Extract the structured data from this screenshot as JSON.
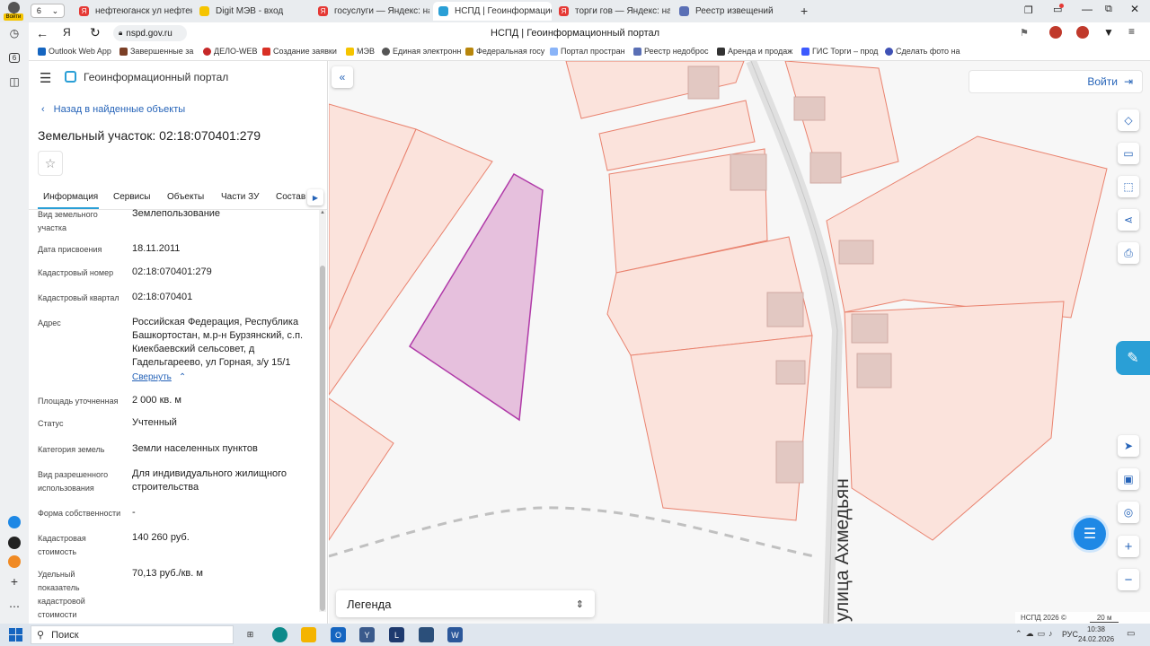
{
  "browser": {
    "tab_count": "6",
    "tabs": [
      {
        "title": "нефтеюганск ул нефтеюга",
        "fav": "#e53935"
      },
      {
        "title": "Digit МЭВ - вход",
        "fav": "#f5c400"
      },
      {
        "title": "госуслуги — Яндекс: нашл",
        "fav": "#e53935"
      },
      {
        "title": "НСПД | Геоинформацио",
        "fav": "#2a9fd6"
      },
      {
        "title": "торги гов — Яндекс: нашл",
        "fav": "#e53935"
      },
      {
        "title": "Реестр извещений",
        "fav": "#5a6fb5"
      }
    ],
    "url": "nspd.gov.ru",
    "page_title": "НСПД | Геоинформационный портал",
    "login_label": "Войти",
    "bookmarks": [
      "Outlook Web App",
      "Завершенные за",
      "ДЕЛО-WEB",
      "Создание заявки",
      "МЭВ",
      "Единая электронн",
      "Федеральная госу",
      "Портал простран",
      "Реестр недоброс",
      "Аренда и продаж",
      "ГИС Торги – прод",
      "Сделать фото на"
    ]
  },
  "panel": {
    "portal_title": "Геоинформационный портал",
    "back_link": "Назад в найденные объекты",
    "object_title": "Земельный участок: 02:18:070401:279",
    "tabs": [
      "Информация",
      "Сервисы",
      "Объекты",
      "Части ЗУ",
      "Состав"
    ],
    "fields": [
      {
        "label": "Вид земельного участка",
        "value": "Землепользование"
      },
      {
        "label": "Дата присвоения",
        "value": "18.11.2011"
      },
      {
        "label": "Кадастровый номер",
        "value": "02:18:070401:279"
      },
      {
        "label": "Кадастровый квартал",
        "value": "02:18:070401"
      },
      {
        "label": "Адрес",
        "value": "Российская Федерация, Республика Башкортостан, м.р-н Бурзянский, с.п. Киекбаевский сельсовет, д Гадельгареево, ул Горная, з/у 15/1"
      },
      {
        "label": "Площадь уточненная",
        "value": "2 000 кв. м"
      },
      {
        "label": "Статус",
        "value": "Учтенный"
      },
      {
        "label": "Категория земель",
        "value": "Земли населенных пунктов"
      },
      {
        "label": "Вид разрешенного использования",
        "value": "Для индивидуального жилищного строительства"
      },
      {
        "label": "Форма собственности",
        "value": "-"
      },
      {
        "label": "Кадастровая стоимость",
        "value": "140 260 руб."
      },
      {
        "label": "Удельный показатель кадастровой стоимости",
        "value": "70,13 руб./кв. м"
      }
    ],
    "collapse_link": "Свернуть"
  },
  "map": {
    "street_label": "улица Ахмедьян",
    "legend_label": "Легенда",
    "copyright": "НСПД 2026 ©",
    "scale": "20 м",
    "colors": {
      "parcel_fill": "#fbe3dc",
      "parcel_stroke": "#e9826e",
      "selected_fill": "#e6c0dd",
      "selected_stroke": "#b03aa8",
      "building": "#e2c8c2"
    }
  },
  "taskbar": {
    "search_label": "Поиск",
    "lang": "РУС",
    "time": "10:38",
    "date": "24.02.2026"
  }
}
